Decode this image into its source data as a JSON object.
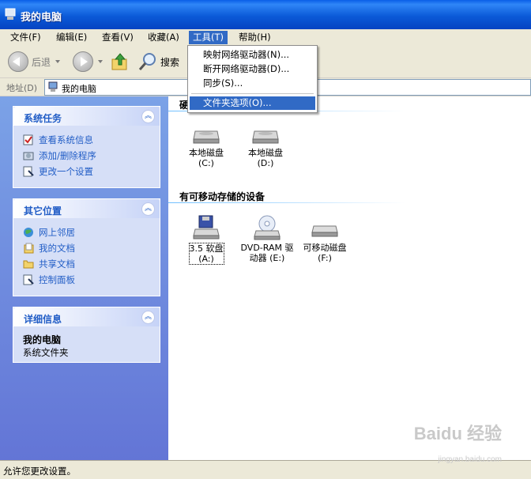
{
  "window": {
    "title": "我的电脑"
  },
  "menubar": [
    {
      "label": "文件(F)",
      "active": false
    },
    {
      "label": "编辑(E)",
      "active": false
    },
    {
      "label": "查看(V)",
      "active": false
    },
    {
      "label": "收藏(A)",
      "active": false
    },
    {
      "label": "工具(T)",
      "active": true
    },
    {
      "label": "帮助(H)",
      "active": false
    }
  ],
  "toolbar": {
    "back_label": "后退",
    "search_label": "搜索"
  },
  "address": {
    "label": "地址(D)",
    "value": "我的电脑"
  },
  "tools_menu": {
    "items": [
      {
        "label": "映射网络驱动器(N)..."
      },
      {
        "label": "断开网络驱动器(D)..."
      },
      {
        "label": "同步(S)..."
      },
      {
        "label": "文件夹选项(O)..."
      }
    ],
    "highlighted": "文件夹选项(O)..."
  },
  "sidebar": {
    "system_tasks": {
      "title": "系统任务",
      "links": [
        "查看系统信息",
        "添加/删除程序",
        "更改一个设置"
      ]
    },
    "other_places": {
      "title": "其它位置",
      "links": [
        "网上邻居",
        "我的文档",
        "共享文档",
        "控制面板"
      ]
    },
    "details": {
      "title": "详细信息",
      "name": "我的电脑",
      "type": "系统文件夹"
    }
  },
  "content": {
    "hard_disks_title_partial": "硬",
    "hard_disks": [
      {
        "name": "本地磁盘",
        "letter": "(C:)"
      },
      {
        "name": "本地磁盘",
        "letter": "(D:)"
      }
    ],
    "removable_title": "有可移动存储的设备",
    "removable": [
      {
        "name": "3.5 软盘",
        "letter": "(A:)",
        "selected": true
      },
      {
        "name": "DVD-RAM 驱",
        "letter": "动器 (E:)",
        "selected": false
      },
      {
        "name": "可移动磁盘",
        "letter": "(F:)",
        "selected": false
      }
    ]
  },
  "statusbar": {
    "text": "允许您更改设置。"
  },
  "watermark": {
    "text": "Baidu 经验",
    "url": "jingyan.baidu.com"
  },
  "colors": {
    "title_blue": "#0b5ad8",
    "menu_highlight": "#316ac5",
    "link_blue": "#215dc6",
    "sidebar_bg": "#7ba2e7"
  }
}
